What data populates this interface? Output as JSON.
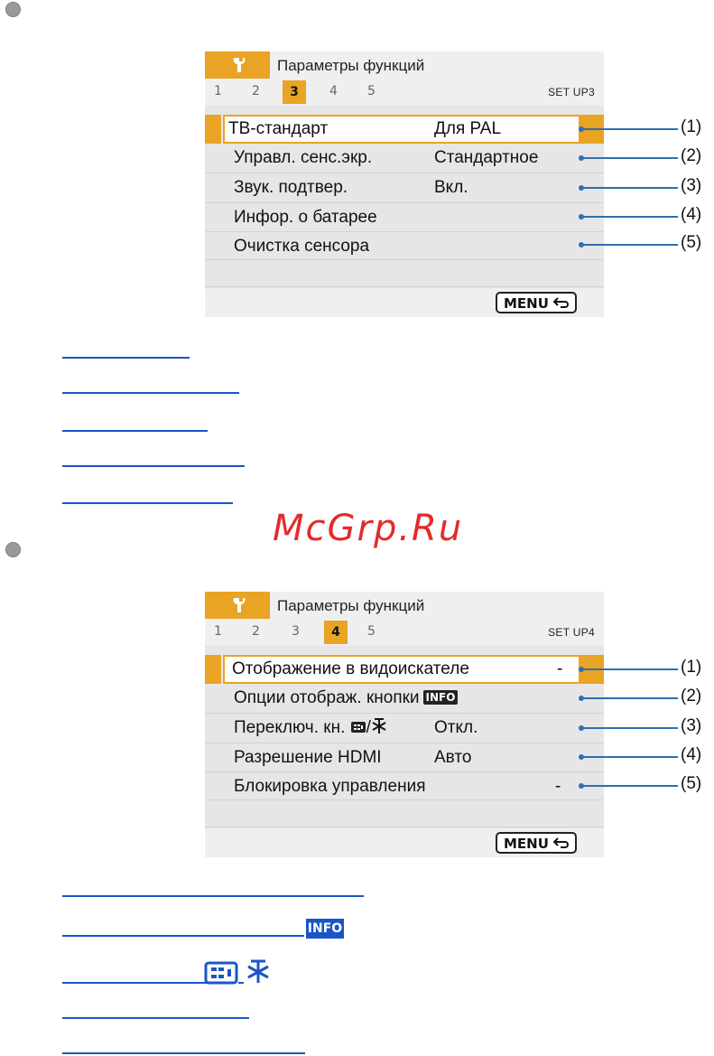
{
  "watermark": "McGrp.Ru",
  "screen1": {
    "title": "Параметры функций",
    "pages": [
      "1",
      "2",
      "3",
      "4",
      "5"
    ],
    "active_page": "3",
    "tab_label": "SET UP3",
    "rows": [
      {
        "label": "ТВ-стандарт",
        "value": "Для PAL"
      },
      {
        "label": "Управл. сенс.экр.",
        "value": "Стандартное"
      },
      {
        "label": "Звук. подтвер.",
        "value": "Вкл."
      },
      {
        "label": "Инфор. о батарее",
        "value": ""
      },
      {
        "label": "Очистка сенсора",
        "value": ""
      }
    ],
    "menu_label": "MENU",
    "callouts": [
      "(1)",
      "(2)",
      "(3)",
      "(4)",
      "(5)"
    ]
  },
  "screen2": {
    "title": "Параметры функций",
    "pages": [
      "1",
      "2",
      "3",
      "4",
      "5"
    ],
    "active_page": "4",
    "tab_label": "SET UP4",
    "rows": [
      {
        "label": "Отображение в видоискателе",
        "value": "-"
      },
      {
        "label": "Опции отображ. кнопки",
        "value": ""
      },
      {
        "label": "Переключ. кн.",
        "value": "Откл."
      },
      {
        "label": "Разрешение HDMI",
        "value": "Авто"
      },
      {
        "label": "Блокировка управления",
        "value": "-"
      }
    ],
    "info_badge": "INFO",
    "menu_label": "MENU",
    "callouts": [
      "(1)",
      "(2)",
      "(3)",
      "(4)",
      "(5)"
    ]
  },
  "links2_badge": "INFO",
  "colors": {
    "accent": "#e9a325",
    "link": "#1a55c8",
    "callout": "#2f6fb0",
    "watermark": "#e22b2b"
  }
}
